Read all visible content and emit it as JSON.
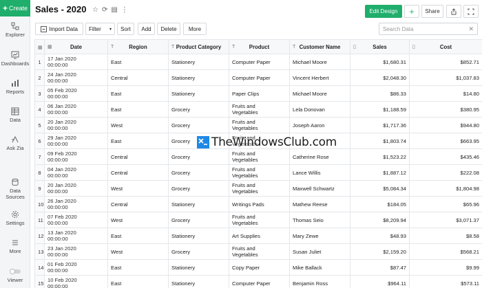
{
  "sidebar": {
    "create_label": "Create",
    "items": [
      {
        "label": "Explorer",
        "icon": "explorer-icon"
      },
      {
        "label": "Dashboards",
        "icon": "dashboards-icon"
      },
      {
        "label": "Reports",
        "icon": "reports-icon"
      },
      {
        "label": "Data",
        "icon": "data-icon"
      },
      {
        "label": "Ask Zia",
        "icon": "ask-zia-icon"
      },
      {
        "label": "Data\nSources",
        "icon": "data-sources-icon"
      },
      {
        "label": "Settings",
        "icon": "settings-icon"
      },
      {
        "label": "More",
        "icon": "more-icon"
      },
      {
        "label": "Viewer",
        "icon": "viewer-toggle-icon"
      }
    ]
  },
  "header": {
    "title": "Sales - 2020",
    "edit_design": "Edit Design",
    "add": "+",
    "share": "Share"
  },
  "toolbar": {
    "import": "Import Data",
    "filter": "Filter",
    "sort": "Sort",
    "add": "Add",
    "delete": "Delete",
    "more": "More",
    "search_placeholder": "Search Data"
  },
  "table": {
    "columns": [
      "Date",
      "Region",
      "Product Category",
      "Product",
      "Customer Name",
      "Sales",
      "Cost"
    ],
    "rows": [
      {
        "n": "1",
        "date": [
          "17 Jan 2020",
          "00:00:00"
        ],
        "region": "East",
        "category": "Stationery",
        "product": [
          "Computer Paper"
        ],
        "customer": "Michael Moore",
        "sales": "$1,680.31",
        "cost": "$852.71"
      },
      {
        "n": "2",
        "date": [
          "24 Jan 2020",
          "00:00:00"
        ],
        "region": "Central",
        "category": "Stationery",
        "product": [
          "Computer Paper"
        ],
        "customer": "Vincent Herbert",
        "sales": "$2,048.30",
        "cost": "$1,037.83"
      },
      {
        "n": "3",
        "date": [
          "05 Feb 2020",
          "00:00:00"
        ],
        "region": "East",
        "category": "Stationery",
        "product": [
          "Paper Clips"
        ],
        "customer": "Michael Moore",
        "sales": "$86.33",
        "cost": "$14.80"
      },
      {
        "n": "4",
        "date": [
          "06 Jan 2020",
          "00:00:00"
        ],
        "region": "East",
        "category": "Grocery",
        "product": [
          "Fruits and",
          "Vegetables"
        ],
        "customer": "Lela Donovan",
        "sales": "$1,188.59",
        "cost": "$380.95"
      },
      {
        "n": "5",
        "date": [
          "20 Jan 2020",
          "00:00:00"
        ],
        "region": "West",
        "category": "Grocery",
        "product": [
          "Fruits and",
          "Vegetables"
        ],
        "customer": "Joseph Aaron",
        "sales": "$1,717.36",
        "cost": "$944.80"
      },
      {
        "n": "6",
        "date": [
          "29 Jan 2020",
          "00:00:00"
        ],
        "region": "East",
        "category": "Grocery",
        "product": [
          "Fruits and",
          "Vegetables"
        ],
        "customer": "",
        "sales": "$1,803.74",
        "cost": "$663.95"
      },
      {
        "n": "7",
        "date": [
          "09 Feb 2020",
          "00:00:00"
        ],
        "region": "Central",
        "category": "Grocery",
        "product": [
          "Fruits and",
          "Vegetables"
        ],
        "customer": "Catherine Rose",
        "sales": "$1,523.22",
        "cost": "$435.46"
      },
      {
        "n": "8",
        "date": [
          "04 Jan 2020",
          "00:00:00"
        ],
        "region": "Central",
        "category": "Grocery",
        "product": [
          "Fruits and",
          "Vegetables"
        ],
        "customer": "Lance Willis",
        "sales": "$1,887.12",
        "cost": "$222.08"
      },
      {
        "n": "9",
        "date": [
          "20 Jan 2020",
          "00:00:00"
        ],
        "region": "West",
        "category": "Grocery",
        "product": [
          "Fruits and",
          "Vegetables"
        ],
        "customer": "Maxwell Schwartz",
        "sales": "$5,084.34",
        "cost": "$1,804.98"
      },
      {
        "n": "10",
        "date": [
          "26 Jan 2020",
          "00:00:00"
        ],
        "region": "Central",
        "category": "Stationery",
        "product": [
          "Writings Pads"
        ],
        "customer": "Mathew Reese",
        "sales": "$184.05",
        "cost": "$65.96"
      },
      {
        "n": "11",
        "date": [
          "07 Feb 2020",
          "00:00:00"
        ],
        "region": "West",
        "category": "Grocery",
        "product": [
          "Fruits and",
          "Vegetables"
        ],
        "customer": "Thomas Seio",
        "sales": "$8,209.94",
        "cost": "$3,071.37"
      },
      {
        "n": "12",
        "date": [
          "13 Jan 2020",
          "00:00:00"
        ],
        "region": "East",
        "category": "Stationery",
        "product": [
          "Art Supplies"
        ],
        "customer": "Mary Zewe",
        "sales": "$48.93",
        "cost": "$8.58"
      },
      {
        "n": "13",
        "date": [
          "23 Jan 2020",
          "00:00:00"
        ],
        "region": "West",
        "category": "Grocery",
        "product": [
          "Fruits and",
          "Vegetables"
        ],
        "customer": "Susan Juliet",
        "sales": "$2,159.20",
        "cost": "$568.21"
      },
      {
        "n": "14",
        "date": [
          "01 Feb 2020",
          "00:00:00"
        ],
        "region": "East",
        "category": "Stationery",
        "product": [
          "Copy Paper"
        ],
        "customer": "Mike Ballack",
        "sales": "$87.47",
        "cost": "$9.99"
      },
      {
        "n": "15",
        "date": [
          "10 Feb 2020",
          "00:00:00"
        ],
        "region": "East",
        "category": "Stationery",
        "product": [
          "Computer Paper"
        ],
        "customer": "Benjamin Ross",
        "sales": "$964.11",
        "cost": "$573.11"
      }
    ]
  },
  "watermark": "TheWindowsClub.com",
  "colors": {
    "accent": "#1fae6b",
    "watermark_blue": "#1e88e5"
  }
}
